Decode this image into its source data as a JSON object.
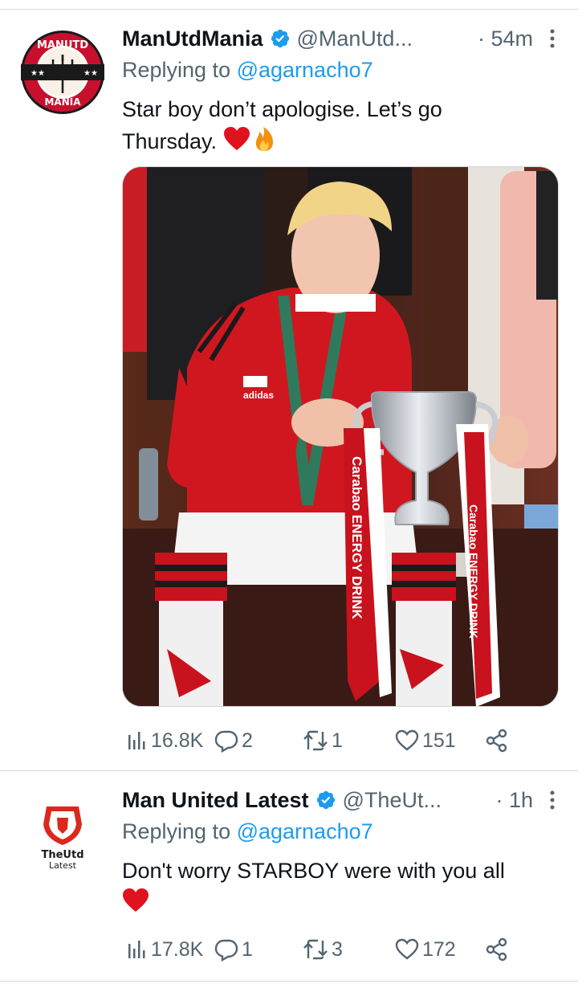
{
  "tweets": [
    {
      "author_name": "ManUtdMania",
      "handle": "@ManUtd...",
      "time": "· 54m",
      "replying_label": "Replying to ",
      "replying_to": "@agarnacho7",
      "text_line1": "Star boy don’t apologise. Let’s go",
      "text_line2": "Thursday.",
      "avatar_text_top": "MANUTD",
      "avatar_text_bottom": "MANIA",
      "media_texts": {
        "ribbon1": "Carabao ENERGY DRINK",
        "ribbon2": "Carabao ENERGY DRINK",
        "shirt_brand": "adidas"
      },
      "actions": {
        "views": "16.8K",
        "replies": "2",
        "retweets": "1",
        "likes": "151"
      }
    },
    {
      "author_name": "Man United Latest",
      "handle": "@TheUt...",
      "time": "· 1h",
      "replying_label": "Replying to ",
      "replying_to": "@agarnacho7",
      "text_line1": "Don't worry STARBOY were with you all",
      "avatar_text_top": "TheUtd",
      "avatar_text_bottom": "Latest",
      "actions": {
        "views": "17.8K",
        "replies": "1",
        "retweets": "3",
        "likes": "172"
      }
    }
  ],
  "icons": {
    "verified": "verified-badge-icon",
    "more": "more-dots-icon",
    "views": "views-bars-icon",
    "reply": "reply-bubble-icon",
    "retweet": "retweet-icon",
    "like": "heart-icon",
    "share": "share-icon",
    "heart_emoji": "red-heart-emoji",
    "fire_emoji": "fire-emoji"
  },
  "colors": {
    "text": "#0f1419",
    "secondary": "#536471",
    "link": "#1d9bf0",
    "divider": "#cfd9de",
    "accent_red": "#da291c"
  }
}
